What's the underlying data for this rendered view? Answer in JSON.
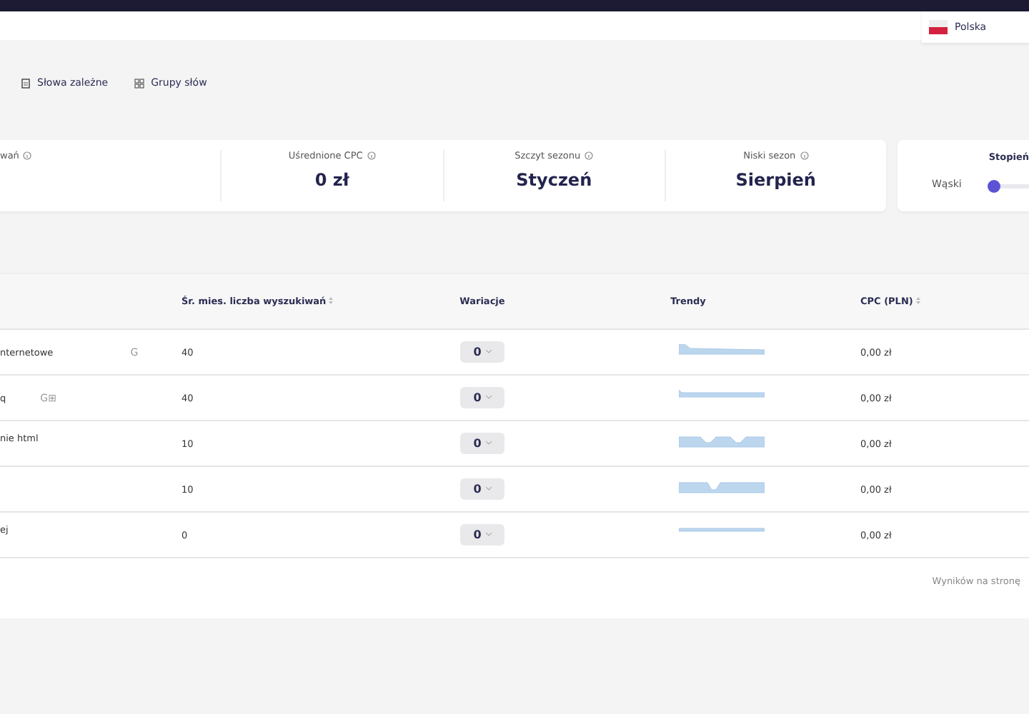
{
  "header": {
    "country": "Polska"
  },
  "tabs": [
    {
      "label": "Słowa zależne"
    },
    {
      "label": "Grupy słów"
    }
  ],
  "stats": [
    {
      "label": "wań"
    },
    {
      "label": "Uśrednione CPC",
      "value": "0 zł"
    },
    {
      "label": "Szczyt sezonu",
      "value": "Styczeń"
    },
    {
      "label": "Niski sezon",
      "value": "Sierpień"
    }
  ],
  "match": {
    "title": "Stopień",
    "label": "Wąski",
    "level": 0.05
  },
  "table": {
    "columns": [
      {
        "sortable": false
      },
      {
        "label": "Śr. mies. liczba wyszukiwań",
        "sortable": true
      },
      {
        "label": "Wariacje",
        "sortable": false
      },
      {
        "label": "Trendy",
        "sortable": false
      },
      {
        "label": "CPC (PLN)",
        "sortable": true
      }
    ],
    "rows": [
      {
        "keyword": "nternetowe",
        "tags": "G",
        "searches": "40",
        "variations": "0",
        "cpc": "0,00 zł"
      },
      {
        "keyword": "q",
        "tags": "G⊞",
        "searches": "40",
        "variations": "0",
        "cpc": "0,00 zł"
      },
      {
        "keyword": "nie html",
        "searches": "10",
        "variations": "0",
        "cpc": "0,00 zł"
      },
      {
        "searches": "10",
        "variations": "0",
        "cpc": "0,00 zł"
      },
      {
        "keyword": "ej",
        "searches": "0",
        "variations": "0",
        "cpc": "0,00 zł"
      }
    ]
  },
  "footer": {
    "per_page_label": "Wyników na stronę"
  }
}
